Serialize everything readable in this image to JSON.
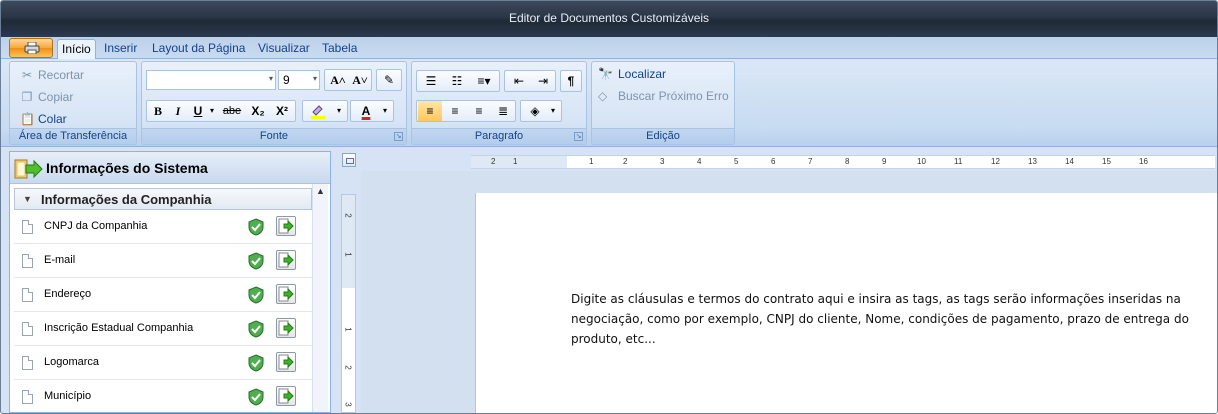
{
  "window": {
    "title": "Editor de Documentos Customizáveis"
  },
  "ribbon_tabs": [
    {
      "label": "Início",
      "active": true
    },
    {
      "label": "Inserir",
      "active": false
    },
    {
      "label": "Layout da Página",
      "active": false
    },
    {
      "label": "Visualizar",
      "active": false
    },
    {
      "label": "Tabela",
      "active": false
    }
  ],
  "clipboard": {
    "title": "Área de Transferência",
    "cut": "Recortar",
    "copy": "Copiar",
    "paste": "Colar"
  },
  "font": {
    "title": "Fonte",
    "name": "",
    "size": "9",
    "bold": "B",
    "italic": "I",
    "underline": "U",
    "strike": "abe",
    "subscript": "X₂",
    "superscript": "X²",
    "grow": "A˄",
    "shrink": "A˅",
    "font_color_label": "A",
    "highlight_color": "#ffff00",
    "font_color": "#e02020"
  },
  "paragraph": {
    "title": "Paragrafo"
  },
  "editing": {
    "title": "Edição",
    "find": "Localizar",
    "find_next_error": "Buscar Próximo Erro"
  },
  "system_panel": {
    "title": "Informações do Sistema",
    "group": "Informações da Companhia",
    "items": [
      {
        "label": "CNPJ da Companhia"
      },
      {
        "label": "E-mail"
      },
      {
        "label": "Endereço"
      },
      {
        "label": "Inscrição Estadual Companhia"
      },
      {
        "label": "Logomarca"
      },
      {
        "label": "Município"
      }
    ]
  },
  "ruler": {
    "horizontal_labels": [
      "2",
      "1",
      "1",
      "2",
      "3",
      "4",
      "5",
      "6",
      "7",
      "8",
      "9",
      "10",
      "11",
      "12",
      "13",
      "14",
      "15",
      "16"
    ],
    "vertical_labels": [
      "2",
      "1",
      "1",
      "2",
      "3"
    ]
  },
  "document": {
    "text": "Digite as cláusulas e termos do contrato aqui e insira as tags, as tags serão informações inseridas na negociação, como por exemplo, CNPJ do cliente, Nome, condições de pagamento, prazo de entrega do produto, etc..."
  }
}
